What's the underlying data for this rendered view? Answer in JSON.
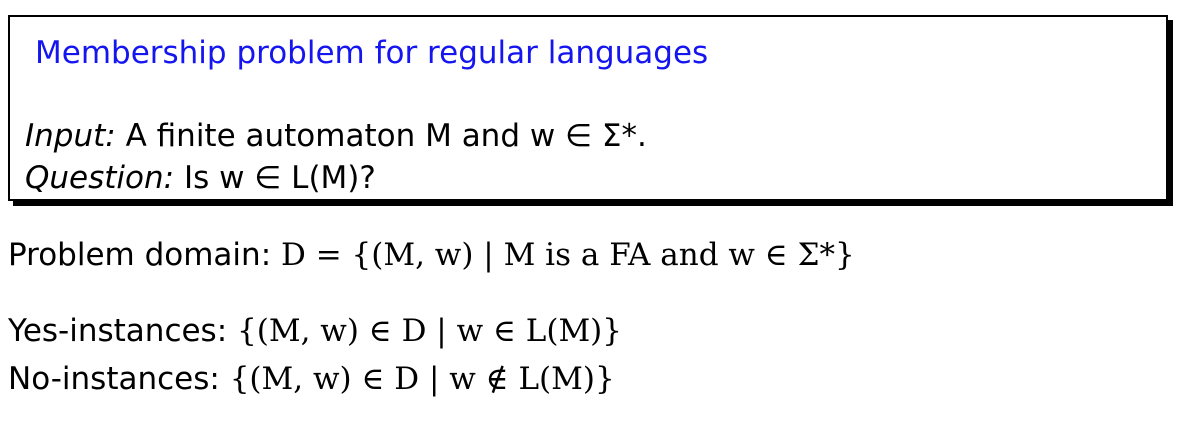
{
  "definition_box": {
    "title": "Membership problem for regular languages",
    "input_label": "Input:",
    "input_text": "A finite automaton M and w ∈ Σ*.",
    "question_label": "Question:",
    "question_text": "Is w ∈ L(M)?"
  },
  "problem_domain": {
    "label": "Problem domain:",
    "formula": "D = {(M, w) | M is a FA and w ∈ Σ*}"
  },
  "yes_instances": {
    "label": "Yes-instances:",
    "formula": "{(M, w) ∈ D | w ∈ L(M)}"
  },
  "no_instances": {
    "label": "No-instances:",
    "formula": "{(M, w) ∈ D | w ∉ L(M)}"
  },
  "colors": {
    "title": "#1515f0",
    "text": "#000000",
    "border": "#000000"
  }
}
